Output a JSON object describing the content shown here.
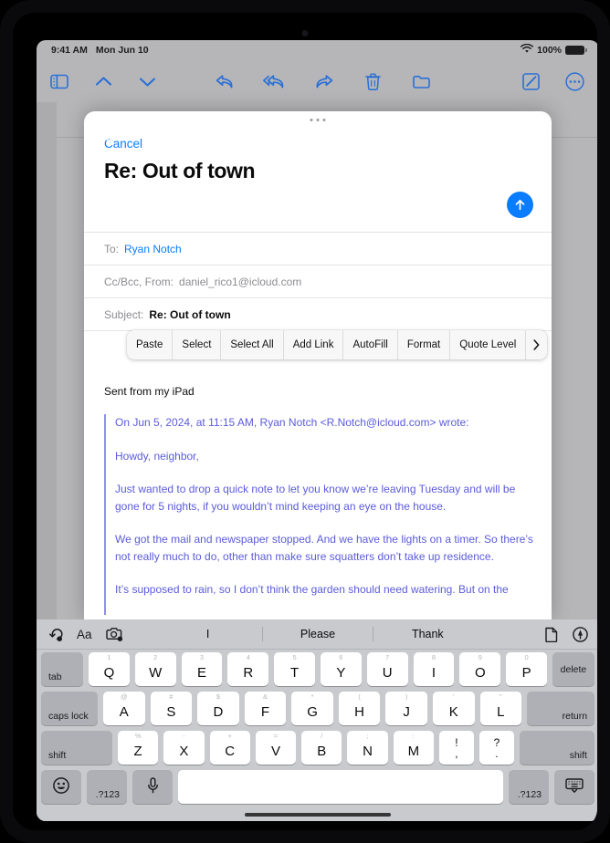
{
  "status_bar": {
    "time": "9:41 AM",
    "date": "Mon Jun 10",
    "wifi_icon": "wifi-icon",
    "battery_percent": "100%"
  },
  "mail_toolbar": {
    "left": [
      {
        "name": "sidebar-toggle-icon",
        "label": "Sidebar"
      },
      {
        "name": "previous-message-icon",
        "label": "Previous Message"
      },
      {
        "name": "next-message-icon",
        "label": "Next Message"
      }
    ],
    "middle": [
      {
        "name": "reply-icon",
        "label": "Reply"
      },
      {
        "name": "reply-all-icon",
        "label": "Reply All"
      },
      {
        "name": "forward-icon",
        "label": "Forward"
      },
      {
        "name": "trash-icon",
        "label": "Delete"
      },
      {
        "name": "folder-icon",
        "label": "Move to Folder"
      }
    ],
    "right": [
      {
        "name": "compose-icon",
        "label": "New Message"
      },
      {
        "name": "more-options-icon",
        "label": "More"
      }
    ]
  },
  "compose": {
    "cancel_label": "Cancel",
    "title": "Re: Out of town",
    "send_icon": "send-arrow-up-icon",
    "grabber": "sheet-grabber",
    "fields": {
      "to_label": "To:",
      "to_value": "Ryan Notch",
      "ccbcc_label": "Cc/Bcc, From:",
      "ccbcc_value": "daniel_rico1@icloud.com",
      "subject_label": "Subject:",
      "subject_value": "Re: Out of town"
    }
  },
  "edit_menu": {
    "items": [
      "Paste",
      "Select",
      "Select All",
      "Add Link",
      "AutoFill",
      "Format",
      "Quote Level"
    ],
    "more_icon": "chevron-right-icon"
  },
  "body": {
    "signature": "Sent from my iPad",
    "quote_paragraphs": [
      "On Jun 5, 2024, at 11:15 AM, Ryan Notch <R.Notch@icloud.com> wrote:",
      "Howdy, neighbor,",
      "Just wanted to drop a quick note to let you know we’re leaving Tuesday and will be gone for 5 nights, if you wouldn’t mind keeping an eye on the house.",
      "We got the mail and newspaper stopped. And we have the lights on a timer. So there’s not really much to do, other than make sure squatters don’t take up residence.",
      "It’s supposed to rain, so I don’t think the garden should need watering. But on the"
    ]
  },
  "keyboard": {
    "predictive_bar": {
      "left_icons": [
        {
          "name": "undo-icon",
          "label": "Undo"
        },
        {
          "name": "text-format-icon",
          "label": "Aa"
        },
        {
          "name": "camera-icon",
          "label": "Insert Photo"
        }
      ],
      "suggestions": [
        "I",
        "Please",
        "Thank"
      ],
      "right_icons": [
        {
          "name": "document-icon",
          "label": "Insert Document"
        },
        {
          "name": "markup-icon",
          "label": "Markup"
        }
      ]
    },
    "row1": {
      "tab": "tab",
      "keys": [
        {
          "hint": "1",
          "main": "Q"
        },
        {
          "hint": "2",
          "main": "W"
        },
        {
          "hint": "3",
          "main": "E"
        },
        {
          "hint": "4",
          "main": "R"
        },
        {
          "hint": "5",
          "main": "T"
        },
        {
          "hint": "6",
          "main": "Y"
        },
        {
          "hint": "7",
          "main": "U"
        },
        {
          "hint": "8",
          "main": "I"
        },
        {
          "hint": "9",
          "main": "O"
        },
        {
          "hint": "0",
          "main": "P"
        }
      ],
      "delete": "delete"
    },
    "row2": {
      "caps_lock": "caps lock",
      "keys": [
        {
          "hint": "@",
          "main": "A"
        },
        {
          "hint": "#",
          "main": "S"
        },
        {
          "hint": "$",
          "main": "D"
        },
        {
          "hint": "&",
          "main": "F"
        },
        {
          "hint": "*",
          "main": "G"
        },
        {
          "hint": "(",
          "main": "H"
        },
        {
          "hint": ")",
          "main": "J"
        },
        {
          "hint": "’",
          "main": "K"
        },
        {
          "hint": "”",
          "main": "L"
        }
      ],
      "return": "return"
    },
    "row3": {
      "shift_left": "shift",
      "keys": [
        {
          "hint": "%",
          "main": "Z"
        },
        {
          "hint": "-",
          "main": "X"
        },
        {
          "hint": "+",
          "main": "C"
        },
        {
          "hint": "=",
          "main": "V"
        },
        {
          "hint": "/",
          "main": "B"
        },
        {
          "hint": ";",
          "main": "N"
        },
        {
          "hint": ":",
          "main": "M"
        }
      ],
      "punct": [
        {
          "top": "!",
          "bot": ","
        },
        {
          "top": "?",
          "bot": "."
        }
      ],
      "shift_right": "shift"
    },
    "row4": {
      "emoji_icon": "emoji-icon",
      "numbers_left": ".?123",
      "mic_icon": "microphone-icon",
      "space": "",
      "numbers_right": ".?123",
      "dismiss_icon": "hide-keyboard-icon"
    }
  },
  "colors": {
    "accent_blue": "#0a7cff",
    "toolbar_blue": "#2a6fd6",
    "quote_purple": "#5b5bdb",
    "quote_bar": "#8f8ff0",
    "screen_bg": "#b6b6b8",
    "keyboard_bg": "#c9cace"
  }
}
